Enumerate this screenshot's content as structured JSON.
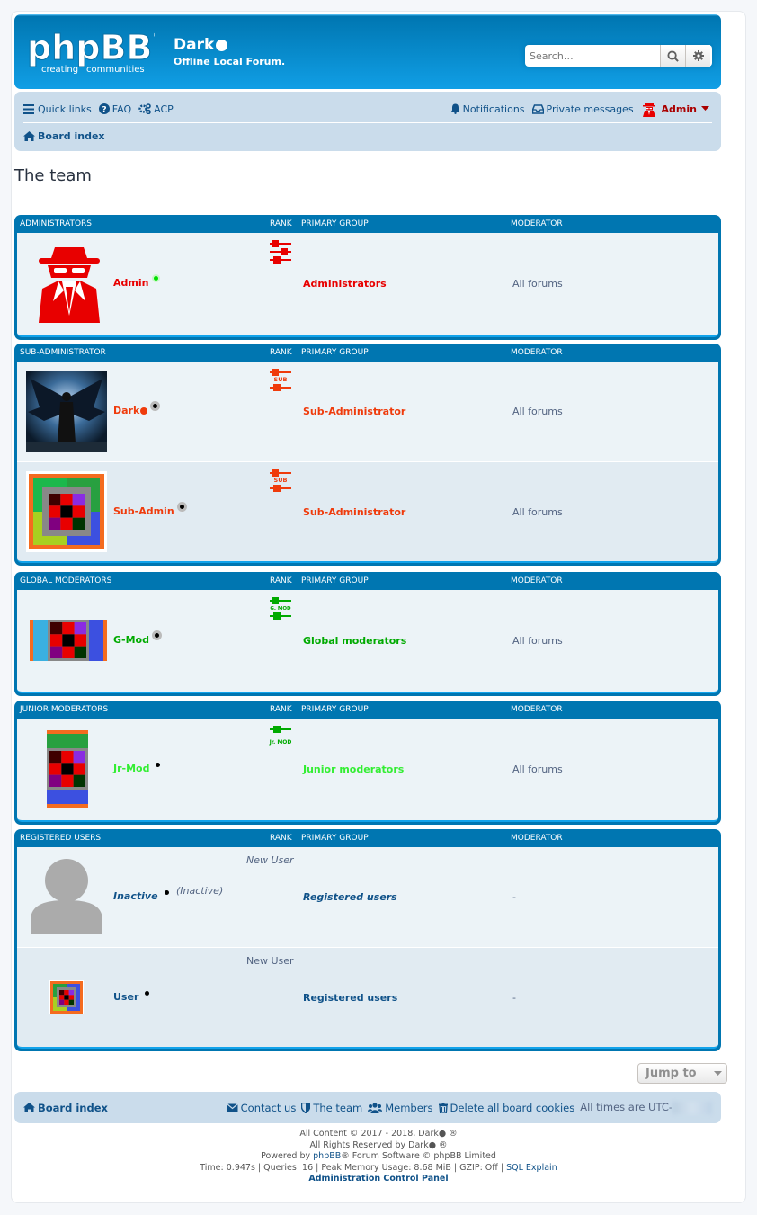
{
  "header": {
    "logo_main": "phpBB",
    "logo_tag_1": "creating",
    "logo_tag_2": "communities",
    "site_name": "Dark",
    "site_desc": "Offline Local Forum.",
    "search_placeholder": "Search…"
  },
  "nav": {
    "quick_links": "Quick links",
    "faq": "FAQ",
    "acp": "ACP",
    "notifications": "Notifications",
    "private_messages": "Private messages",
    "user": "Admin",
    "board_index": "Board index"
  },
  "page_title": "The team",
  "columns": {
    "rank": "RANK",
    "primary_group": "PRIMARY GROUP",
    "moderator": "MODERATOR"
  },
  "groups": [
    {
      "heading": "ADMINISTRATORS",
      "members": [
        {
          "name": "Admin",
          "name_color": "#e80000",
          "group": "Administrators",
          "group_color": "#e80000",
          "moderator": "All forums",
          "rank_img": "rank-admin-icon",
          "online": true
        }
      ]
    },
    {
      "heading": "SUB-ADMINISTRATOR",
      "members": [
        {
          "name": "Dark",
          "name_color": "#ef3b0c",
          "group": "Sub-Administrator",
          "group_color": "#ef3b0c",
          "moderator": "All forums",
          "rank_img": "rank-sub-icon",
          "rank_label": "SUB"
        },
        {
          "name": "Sub-Admin",
          "name_color": "#ef3b0c",
          "group": "Sub-Administrator",
          "group_color": "#ef3b0c",
          "moderator": "All forums",
          "rank_img": "rank-sub-icon",
          "rank_label": "SUB"
        }
      ]
    },
    {
      "heading": "GLOBAL MODERATORS",
      "members": [
        {
          "name": "G-Mod",
          "name_color": "#00aa00",
          "group": "Global moderators",
          "group_color": "#00aa00",
          "moderator": "All forums",
          "rank_img": "rank-gmod-icon",
          "rank_label": "G. MOD"
        }
      ]
    },
    {
      "heading": "JUNIOR MODERATORS",
      "members": [
        {
          "name": "Jr-Mod",
          "name_color": "#33ee33",
          "group": "Junior moderators",
          "group_color": "#33ee33",
          "moderator": "All forums",
          "rank_img": "rank-jrmod-icon",
          "rank_label": "Jr. MOD"
        }
      ]
    },
    {
      "heading": "REGISTERED USERS",
      "members": [
        {
          "name": "Inactive",
          "name_color": "#105289",
          "group": "Registered users",
          "group_color": "#105289",
          "moderator": "-",
          "rank_title": "New User",
          "inactive_tag": "(Inactive)"
        },
        {
          "name": "User",
          "name_color": "#105289",
          "group": "Registered users",
          "group_color": "#105289",
          "moderator": "-",
          "rank_title": "New User"
        }
      ]
    }
  ],
  "jump_to": "Jump to",
  "footer_nav": {
    "board_index": "Board index",
    "contact": "Contact us",
    "team": "The team",
    "members": "Members",
    "delete_cookies": "Delete all board cookies",
    "timezone": "All times are UTC-"
  },
  "copyright": {
    "line1": "All Content © 2017 - 2018, Dark",
    "line2": "All Rights Reserved by Dark",
    "powered_prefix": "Powered by",
    "powered_link": "phpBB",
    "powered_suffix": "® Forum Software © phpBB Limited",
    "debug": "Time: 0.947s | Queries: 16 | Peak Memory Usage: 8.68 MiB | GZIP: Off |",
    "sql_explain": "SQL Explain",
    "acp_link": "Administration Control Panel"
  }
}
